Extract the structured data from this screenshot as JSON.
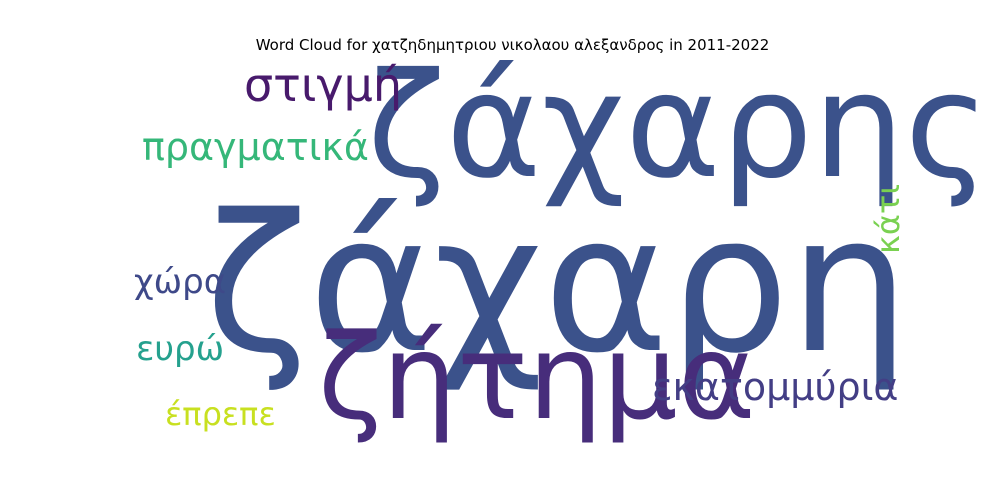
{
  "title": "Word Cloud for χατζηδημητριου νικολαου αλεξανδρος in 2011-2022",
  "words": [
    {
      "text": "ζάχαρη",
      "color": "#3b528b"
    },
    {
      "text": "ζάχαρης",
      "color": "#3b528b"
    },
    {
      "text": "ζήτημα",
      "color": "#472d7b"
    },
    {
      "text": "στιγμή",
      "color": "#481a6c"
    },
    {
      "text": "πραγματικά",
      "color": "#35b779"
    },
    {
      "text": "εκατομμύρια",
      "color": "#433e85"
    },
    {
      "text": "χώρα",
      "color": "#3e4989"
    },
    {
      "text": "ευρώ",
      "color": "#25a18e"
    },
    {
      "text": "έπρεπε",
      "color": "#c8e020"
    },
    {
      "text": "κάτι",
      "color": "#7ad151"
    }
  ]
}
